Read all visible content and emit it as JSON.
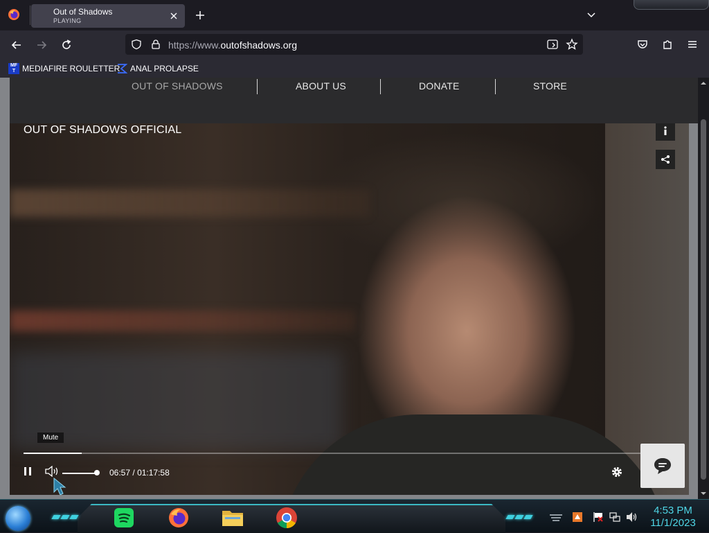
{
  "browser": {
    "tab": {
      "title": "Out of Shadows",
      "subtitle": "PLAYING"
    },
    "url": {
      "prefix": "https://www.",
      "domain": "outofshadows.org"
    },
    "bookmarks": [
      {
        "label": "MEDIAFIRE ROULETTER",
        "icon": "mediafire-favicon"
      },
      {
        "label": "ANAL PROLAPSE",
        "icon": "sigma-favicon"
      }
    ]
  },
  "site": {
    "nav": [
      {
        "label": "OUT OF SHADOWS",
        "active": true
      },
      {
        "label": "ABOUT US"
      },
      {
        "label": "DONATE"
      },
      {
        "label": "STORE"
      }
    ]
  },
  "video": {
    "title": "OUT OF SHADOWS OFFICIAL",
    "tooltip": "Mute",
    "current_time": "06:57",
    "separator": "/",
    "duration": "01:17:58",
    "progress_fraction": 0.089,
    "volume_fraction": 1.0,
    "state": "playing"
  },
  "taskbar": {
    "apps": [
      "spotify-icon",
      "firefox-icon",
      "file-explorer-icon",
      "chrome-icon"
    ],
    "tray_icons": [
      "keyboard-icon",
      "notification-icon",
      "flag-icon",
      "network-icon",
      "volume-icon"
    ],
    "clock": {
      "time": "4:53 PM",
      "date": "11/1/2023"
    }
  },
  "colors": {
    "browser_bg": "#1c1b22",
    "toolbar_bg": "#2b2a33",
    "site_nav_bg": "#2b2b2d",
    "taskbar_accent": "#4fd6e6"
  }
}
